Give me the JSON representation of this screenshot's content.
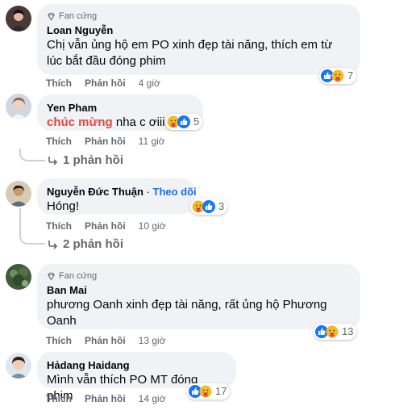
{
  "comments": [
    {
      "badge": "Fan cứng",
      "name": "Loan Nguyễn",
      "text": "Chị vẫn ủng hộ em PO xinh đẹp tài năng, thích em từ lúc bắt đầu đóng phim",
      "reaction_count": "7",
      "like_label": "Thích",
      "reply_label": "Phản hồi",
      "time": "4 giờ"
    },
    {
      "name": "Yen Pham",
      "text_highlight": "chúc mừng",
      "text": "nha c ơiii",
      "reaction_count": "5",
      "like_label": "Thích",
      "reply_label": "Phản hồi",
      "time": "11 giờ",
      "view_replies": "1 phản hồi"
    },
    {
      "name": "Nguyễn Đức Thuận",
      "separator": "·",
      "follow_label": "Theo dõi",
      "text": "Hóng!",
      "reaction_count": "3",
      "like_label": "Thích",
      "reply_label": "Phản hồi",
      "time": "10 giờ",
      "view_replies": "2 phản hồi"
    },
    {
      "badge": "Fan cứng",
      "name": "Ban Mai",
      "text": "phương Oanh xinh đẹp tài năng, rất ủng hộ Phương Oanh",
      "reaction_count": "13",
      "like_label": "Thích",
      "reply_label": "Phản hồi",
      "time": "13 giờ"
    },
    {
      "name": "Hảdang Haidang",
      "text": "Mình vẫn thích PO MT đóng phim",
      "reaction_count": "17",
      "like_label": "Thích",
      "reply_label": "Phản hồi",
      "time": "14 giờ"
    }
  ],
  "icons": {
    "badge": "diamond-icon",
    "like": "like-reaction-icon",
    "care": "care-reaction-icon",
    "replies_arrow": "reply-arrow-icon"
  },
  "colors": {
    "bubble": "#f0f2f5",
    "like_blue": "#1877f2",
    "care_yellow": "#f7b928",
    "follow_blue": "#216fdb",
    "highlight_red": "#e2483d",
    "meta_gray": "#65676b"
  }
}
